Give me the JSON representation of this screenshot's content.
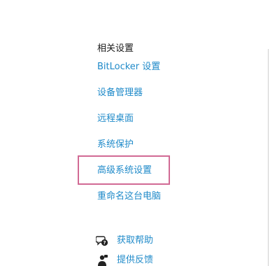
{
  "related": {
    "title": "相关设置",
    "links": [
      "BitLocker 设置",
      "设备管理器",
      "远程桌面",
      "系统保护",
      "高级系统设置",
      "重命名这台电脑"
    ]
  },
  "help": {
    "items": [
      {
        "label": "获取帮助",
        "icon": "get-help-icon"
      },
      {
        "label": "提供反馈",
        "icon": "feedback-icon"
      }
    ]
  },
  "colors": {
    "link": "#1f8ac9",
    "highlight": "#d16a94"
  }
}
